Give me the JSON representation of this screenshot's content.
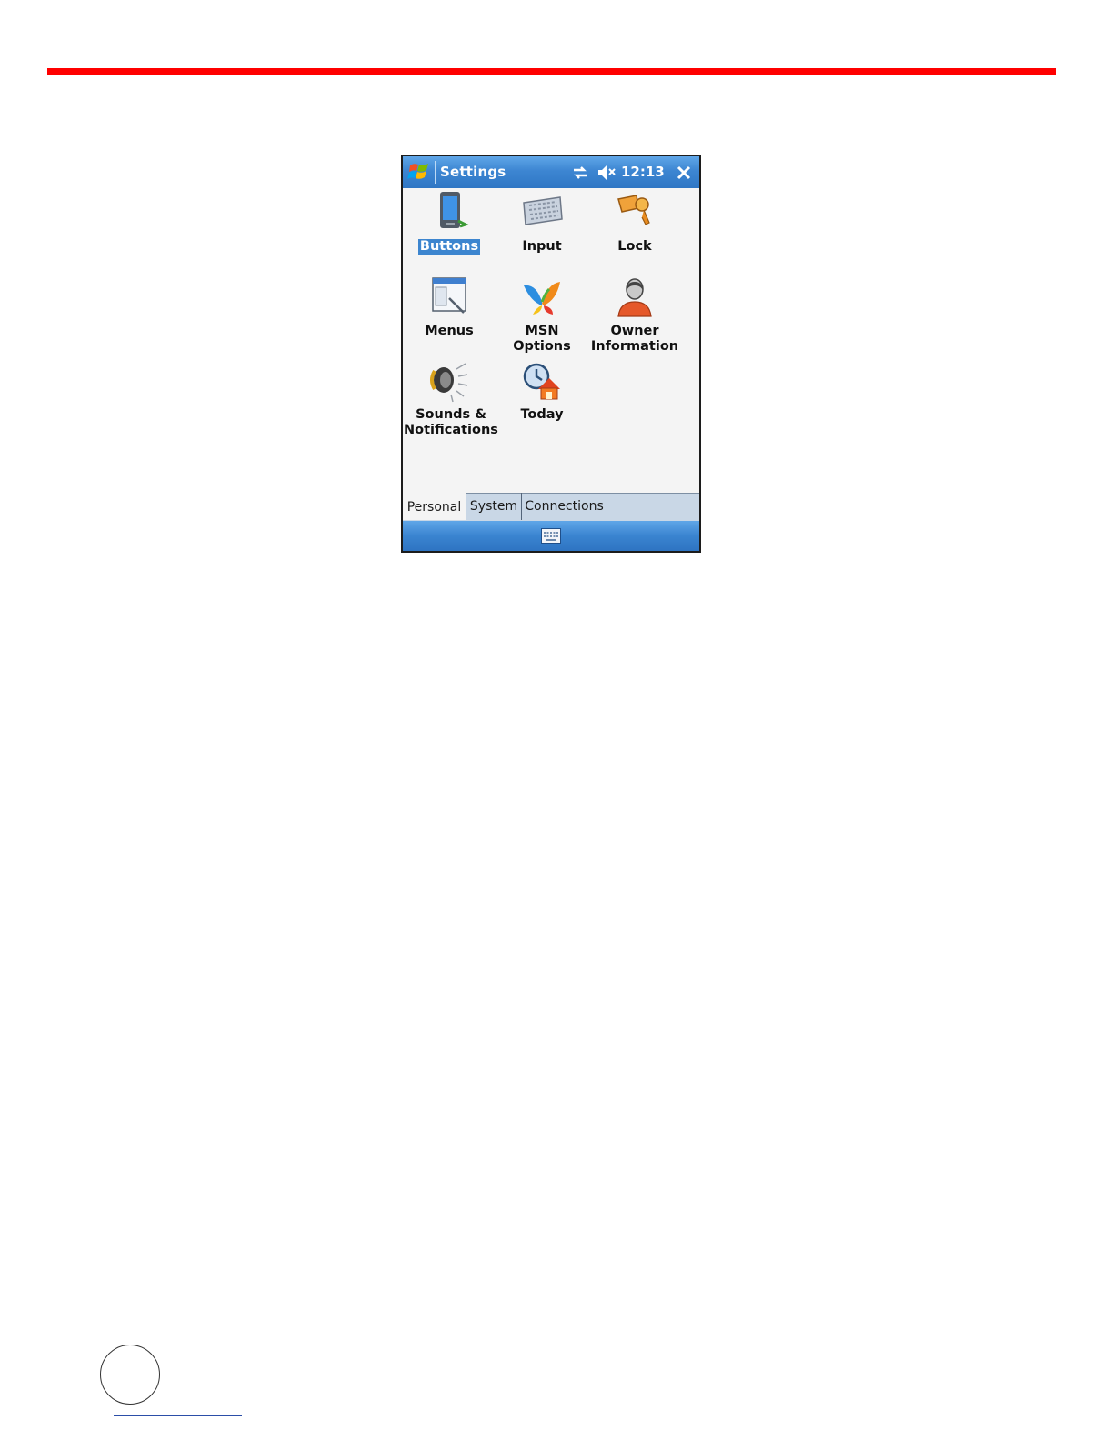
{
  "window": {
    "title": "Settings",
    "clock": "12:13"
  },
  "items": [
    {
      "label": "Buttons",
      "icon": "buttons-icon",
      "selected": true
    },
    {
      "label": "Input",
      "icon": "keyboard-icon"
    },
    {
      "label": "Lock",
      "icon": "keys-icon"
    },
    {
      "label": "Menus",
      "icon": "menus-icon"
    },
    {
      "label": "MSN Options",
      "icon": "msn-butterfly-icon"
    },
    {
      "label_line1": "Owner",
      "label_line2": "Information",
      "icon": "owner-icon"
    },
    {
      "label_line1": "Sounds &",
      "label_line2": "Notifications",
      "icon": "speaker-icon"
    },
    {
      "label": "Today",
      "icon": "today-icon"
    }
  ],
  "tabs": [
    {
      "label": "Personal",
      "active": true
    },
    {
      "label": "System"
    },
    {
      "label": "Connections"
    }
  ],
  "colors": {
    "accent_rule": "#ff0000",
    "titlebar_blue": "#3d86d2",
    "selection_blue": "#3c85cf"
  }
}
